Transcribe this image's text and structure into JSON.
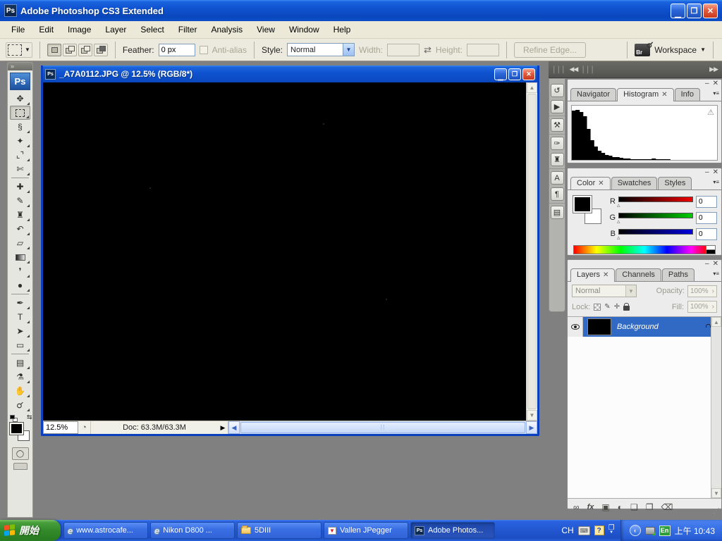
{
  "app": {
    "title": "Adobe Photoshop CS3 Extended",
    "icon_text": "Ps"
  },
  "menu": {
    "items": [
      "File",
      "Edit",
      "Image",
      "Layer",
      "Select",
      "Filter",
      "Analysis",
      "View",
      "Window",
      "Help"
    ]
  },
  "options": {
    "feather_label": "Feather:",
    "feather_value": "0 px",
    "anti_alias_label": "Anti-alias",
    "style_label": "Style:",
    "style_value": "Normal",
    "width_label": "Width:",
    "height_label": "Height:",
    "refine_edge_label": "Refine Edge...",
    "bridge_icon_text": "Br",
    "workspace_label": "Workspace"
  },
  "toolbox": {
    "collapse_glyph": "»",
    "logo": "Ps",
    "tools": [
      {
        "name": "move-tool",
        "glyph": "✥"
      },
      {
        "name": "rectangular-marquee-tool",
        "marquee": true,
        "selected": true
      },
      {
        "name": "lasso-tool",
        "glyph": "§"
      },
      {
        "name": "quick-selection-tool",
        "glyph": "✦"
      },
      {
        "name": "crop-tool",
        "glyph": "⌞⌝"
      },
      {
        "name": "slice-tool",
        "glyph": "✄"
      },
      {
        "divider": true
      },
      {
        "name": "healing-brush-tool",
        "glyph": "✚"
      },
      {
        "name": "brush-tool",
        "glyph": "✎"
      },
      {
        "name": "clone-stamp-tool",
        "glyph": "♜"
      },
      {
        "name": "history-brush-tool",
        "glyph": "↶"
      },
      {
        "name": "eraser-tool",
        "glyph": "▱"
      },
      {
        "name": "gradient-tool",
        "gradient": true
      },
      {
        "name": "blur-tool",
        "glyph": "❜"
      },
      {
        "name": "dodge-tool",
        "glyph": "●"
      },
      {
        "divider": true
      },
      {
        "name": "pen-tool",
        "glyph": "✒"
      },
      {
        "name": "type-tool",
        "glyph": "T"
      },
      {
        "name": "path-selection-tool",
        "glyph": "➤"
      },
      {
        "name": "shape-tool",
        "glyph": "▭"
      },
      {
        "divider": true
      },
      {
        "name": "notes-tool",
        "glyph": "▤"
      },
      {
        "name": "eyedropper-tool",
        "glyph": "⚗"
      },
      {
        "name": "hand-tool",
        "glyph": "✋"
      },
      {
        "name": "zoom-tool",
        "glyph": "⚲"
      }
    ]
  },
  "document": {
    "title": "_A7A0112.JPG @ 12.5% (RGB/8*)",
    "icon_text": "Ps",
    "zoom": "12.5%",
    "doc_size": "Doc: 63.3M/63.3M"
  },
  "dock": {
    "collapse_left": "◀◀",
    "collapse_right": "▶▶",
    "icon_groups": [
      [
        {
          "name": "history-panel-icon",
          "glyph": "↺"
        },
        {
          "name": "actions-panel-icon",
          "glyph": "▶"
        }
      ],
      [
        {
          "name": "tool-presets-panel-icon",
          "glyph": "⚒"
        }
      ],
      [
        {
          "name": "brushes-panel-icon",
          "glyph": "✑"
        },
        {
          "name": "clone-source-panel-icon",
          "glyph": "♜"
        }
      ],
      [
        {
          "name": "character-panel-icon",
          "glyph": "A"
        },
        {
          "name": "paragraph-panel-icon",
          "glyph": "¶"
        }
      ],
      [
        {
          "name": "layer-comps-panel-icon",
          "glyph": "▤"
        }
      ]
    ]
  },
  "panels": {
    "nav_group": {
      "tabs": [
        {
          "label": "Navigator",
          "active": false
        },
        {
          "label": "Histogram",
          "active": true,
          "close": true
        },
        {
          "label": "Info",
          "active": false
        }
      ]
    },
    "histogram": {
      "warning_icon": "⚠",
      "values": [
        98,
        100,
        96,
        88,
        62,
        40,
        27,
        19,
        14,
        10,
        8,
        6,
        5,
        4,
        3,
        2.5,
        2,
        1.8,
        1.5,
        1.3,
        1.1,
        1,
        2.2,
        1,
        1.6,
        0.8,
        1.2,
        0.5,
        0.4,
        0.3,
        0.3,
        0.2,
        0.2,
        0.1,
        0.1,
        0.1,
        0,
        0,
        0,
        0
      ]
    },
    "color_group": {
      "tabs": [
        {
          "label": "Color",
          "active": true,
          "close": true
        },
        {
          "label": "Swatches",
          "active": false
        },
        {
          "label": "Styles",
          "active": false
        }
      ],
      "channels": [
        {
          "label": "R",
          "value": "0"
        },
        {
          "label": "G",
          "value": "0"
        },
        {
          "label": "B",
          "value": "0"
        }
      ]
    },
    "layers_group": {
      "tabs": [
        {
          "label": "Layers",
          "active": true,
          "close": true
        },
        {
          "label": "Channels",
          "active": false
        },
        {
          "label": "Paths",
          "active": false
        }
      ],
      "blend_mode": "Normal",
      "opacity_label": "Opacity:",
      "opacity_value": "100%",
      "lock_label": "Lock:",
      "fill_label": "Fill:",
      "fill_value": "100%",
      "layers": [
        {
          "name": "Background",
          "locked": true,
          "visible": true
        }
      ],
      "bottom_buttons": [
        {
          "name": "link-layers-button",
          "glyph": "∞"
        },
        {
          "name": "layer-style-button",
          "glyph": "fx",
          "fx": true
        },
        {
          "name": "add-layer-mask-button",
          "glyph": "▣"
        },
        {
          "name": "adjustment-layer-button",
          "glyph": "◐"
        },
        {
          "name": "new-group-button",
          "glyph": "❏"
        },
        {
          "name": "new-layer-button",
          "glyph": "❐"
        },
        {
          "name": "delete-layer-button",
          "glyph": "⌫"
        }
      ]
    }
  },
  "taskbar": {
    "start_label": "開始",
    "tasks": [
      {
        "label": "www.astrocafe...",
        "icon": "ie"
      },
      {
        "label": "Nikon D800 ...",
        "icon": "ie"
      },
      {
        "label": "5DIII",
        "icon": "folder"
      },
      {
        "label": "Vallen JPegger",
        "icon": "vallen"
      },
      {
        "label": "Adobe Photos...",
        "icon": "ps",
        "active": true
      }
    ],
    "lang_indicator": "CH",
    "help_glyph": "?",
    "lang_badge": "En",
    "time": "上午 10:43"
  }
}
